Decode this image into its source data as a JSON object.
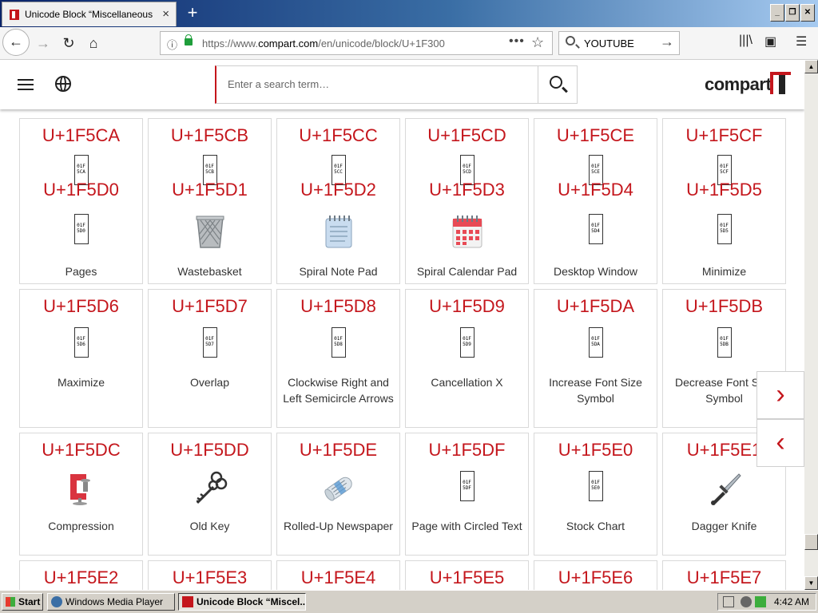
{
  "browser": {
    "tab_title": "Unicode Block “Miscellaneous Symb",
    "tab_close": "×",
    "new_tab": "+",
    "url_prefix": "https://www.",
    "url_domain": "compart.com",
    "url_path": "/en/unicode/block/U+1F300",
    "search_value": "YOUTUBE",
    "page_actions": "•••"
  },
  "site": {
    "search_placeholder": "Enter a search term…",
    "logo": "compart"
  },
  "cards": [
    {
      "code": "U+1F5CA",
      "name": "",
      "tofu": "01F\n5CA"
    },
    {
      "code": "U+1F5CB",
      "name": "",
      "tofu": "01F\n5CB"
    },
    {
      "code": "U+1F5CC",
      "name": "",
      "tofu": "01F\n5CC"
    },
    {
      "code": "U+1F5CD",
      "name": "",
      "tofu": "01F\n5CD"
    },
    {
      "code": "U+1F5CE",
      "name": "",
      "tofu": "01F\n5CE"
    },
    {
      "code": "U+1F5CF",
      "name": "",
      "tofu": "01F\n5CF"
    },
    {
      "code": "U+1F5D0",
      "name": "Pages",
      "tofu": "01F\n5D0"
    },
    {
      "code": "U+1F5D1",
      "name": "Wastebasket",
      "icon": "wastebasket-icon"
    },
    {
      "code": "U+1F5D2",
      "name": "Spiral Note Pad",
      "icon": "spiral-note-pad-icon"
    },
    {
      "code": "U+1F5D3",
      "name": "Spiral Calendar Pad",
      "icon": "spiral-calendar-icon"
    },
    {
      "code": "U+1F5D4",
      "name": "Desktop Window",
      "tofu": "01F\n5D4"
    },
    {
      "code": "U+1F5D5",
      "name": "Minimize",
      "tofu": "01F\n5D5"
    },
    {
      "code": "U+1F5D6",
      "name": "Maximize",
      "tofu": "01F\n5D6"
    },
    {
      "code": "U+1F5D7",
      "name": "Overlap",
      "tofu": "01F\n5D7"
    },
    {
      "code": "U+1F5D8",
      "name": "Clockwise Right and Left Semicircle Arrows",
      "tofu": "01F\n5D8"
    },
    {
      "code": "U+1F5D9",
      "name": "Cancellation X",
      "tofu": "01F\n5D9"
    },
    {
      "code": "U+1F5DA",
      "name": "Increase Font Size Symbol",
      "tofu": "01F\n5DA"
    },
    {
      "code": "U+1F5DB",
      "name": "Decrease Font Size Symbol",
      "tofu": "01F\n5DB"
    },
    {
      "code": "U+1F5DC",
      "name": "Compression",
      "icon": "clamp-icon"
    },
    {
      "code": "U+1F5DD",
      "name": "Old Key",
      "icon": "old-key-icon"
    },
    {
      "code": "U+1F5DE",
      "name": "Rolled-Up Newspaper",
      "icon": "rolled-newspaper-icon"
    },
    {
      "code": "U+1F5DF",
      "name": "Page with Circled Text",
      "tofu": "01F\n5DF"
    },
    {
      "code": "U+1F5E0",
      "name": "Stock Chart",
      "tofu": "01F\n5E0"
    },
    {
      "code": "U+1F5E1",
      "name": "Dagger Knife",
      "icon": "dagger-icon"
    },
    {
      "code": "U+1F5E2",
      "name": ""
    },
    {
      "code": "U+1F5E3",
      "name": ""
    },
    {
      "code": "U+1F5E4",
      "name": ""
    },
    {
      "code": "U+1F5E5",
      "name": ""
    },
    {
      "code": "U+1F5E6",
      "name": ""
    },
    {
      "code": "U+1F5E7",
      "name": ""
    }
  ],
  "nav_arrows": {
    "next": "›",
    "prev": "‹"
  },
  "taskbar": {
    "start": "Start",
    "items": [
      "Windows Media Player",
      "Unicode Block “Miscel..."
    ],
    "clock": "4:42 AM"
  },
  "colors": {
    "accent": "#c4161c",
    "titlebar": "#0a246a"
  }
}
